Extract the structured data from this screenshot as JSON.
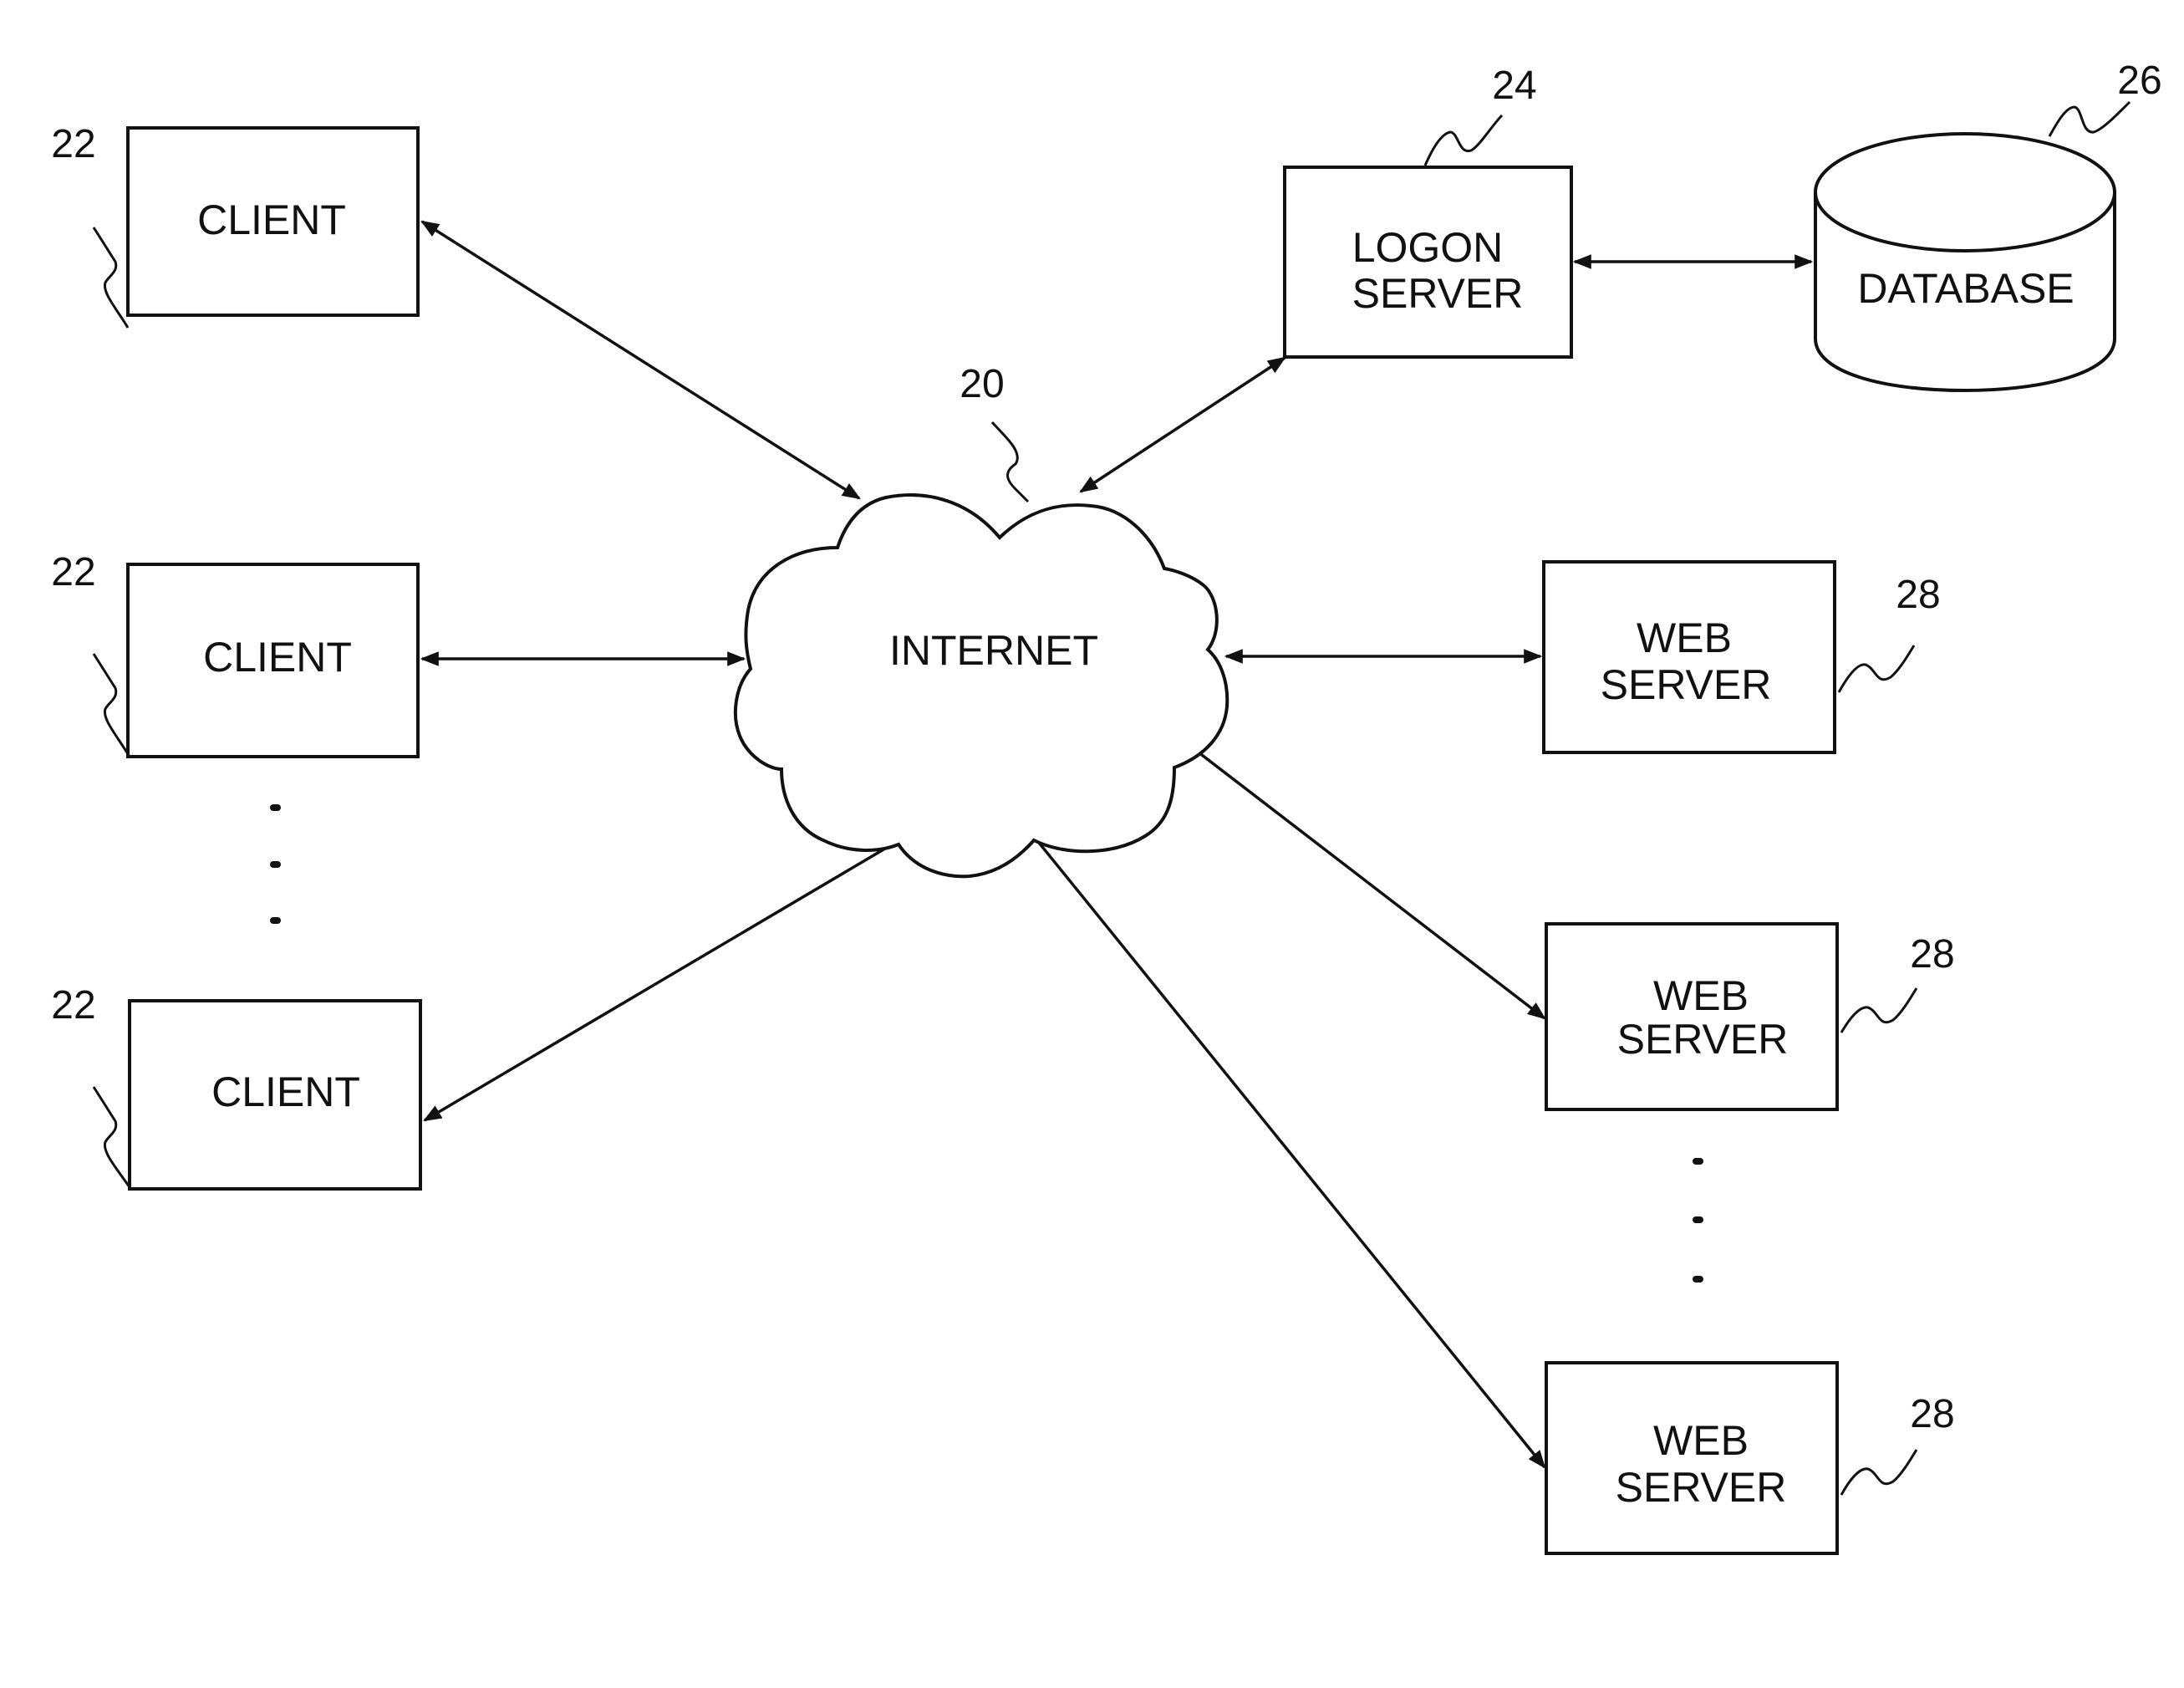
{
  "diagram": {
    "type": "network-architecture",
    "colors": {
      "stroke": "#111111",
      "background": "#ffffff"
    },
    "nodes": {
      "internet": {
        "label": "INTERNET",
        "ref": "20",
        "shape": "cloud"
      },
      "client_1": {
        "label": "CLIENT",
        "ref": "22",
        "shape": "rectangle"
      },
      "client_2": {
        "label": "CLIENT",
        "ref": "22",
        "shape": "rectangle"
      },
      "client_3": {
        "label": "CLIENT",
        "ref": "22",
        "shape": "rectangle"
      },
      "logon_server": {
        "label_line1": "LOGON",
        "label_line2": "SERVER",
        "ref": "24",
        "shape": "rectangle"
      },
      "database": {
        "label": "DATABASE",
        "ref": "26",
        "shape": "cylinder"
      },
      "web_server_1": {
        "label_line1": "WEB",
        "label_line2": "SERVER",
        "ref": "28",
        "shape": "rectangle"
      },
      "web_server_2": {
        "label_line1": "WEB",
        "label_line2": "SERVER",
        "ref": "28",
        "shape": "rectangle"
      },
      "web_server_3": {
        "label_line1": "WEB",
        "label_line2": "SERVER",
        "ref": "28",
        "shape": "rectangle"
      }
    },
    "edges": [
      {
        "from": "client_1",
        "to": "internet",
        "bidirectional": true
      },
      {
        "from": "client_2",
        "to": "internet",
        "bidirectional": true
      },
      {
        "from": "client_3",
        "to": "internet",
        "bidirectional": true
      },
      {
        "from": "internet",
        "to": "logon_server",
        "bidirectional": true
      },
      {
        "from": "logon_server",
        "to": "database",
        "bidirectional": true
      },
      {
        "from": "internet",
        "to": "web_server_1",
        "bidirectional": true
      },
      {
        "from": "internet",
        "to": "web_server_2",
        "bidirectional": true
      },
      {
        "from": "internet",
        "to": "web_server_3",
        "bidirectional": true
      }
    ],
    "ellipses": [
      "clients-continuation",
      "web-servers-continuation"
    ]
  }
}
